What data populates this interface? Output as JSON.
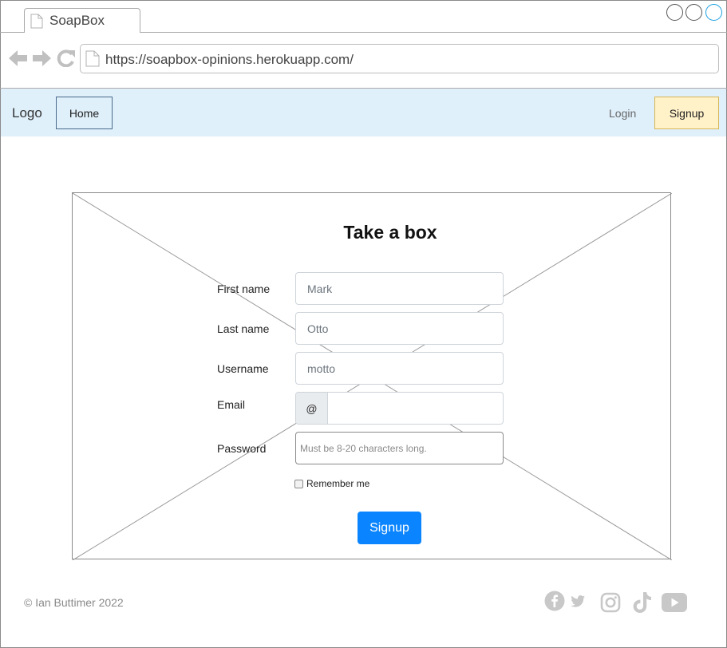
{
  "browser": {
    "tab_title": "SoapBox",
    "url": "https://soapbox-opinions.herokuapp.com/"
  },
  "navbar": {
    "logo": "Logo",
    "home": "Home",
    "login": "Login",
    "signup": "Signup"
  },
  "form": {
    "title": "Take a box",
    "first_name": {
      "label": "First name",
      "value": "Mark"
    },
    "last_name": {
      "label": "Last name",
      "value": "Otto"
    },
    "username": {
      "label": "Username",
      "value": "motto"
    },
    "email": {
      "label": "Email",
      "prefix": "@",
      "value": ""
    },
    "password": {
      "label": "Password",
      "placeholder": "Must be 8-20 characters long."
    },
    "remember": "Remember me",
    "submit": "Signup"
  },
  "footer": {
    "copyright": "© Ian Buttimer 2022",
    "social_icons": [
      "facebook-icon",
      "twitter-icon",
      "instagram-icon",
      "tiktok-icon",
      "youtube-icon"
    ]
  },
  "colors": {
    "navbar_bg": "#dff0fb",
    "signup_nav_bg": "#fff1c8",
    "primary_button": "#0a84ff",
    "icon_gray": "#c8c8c8"
  }
}
